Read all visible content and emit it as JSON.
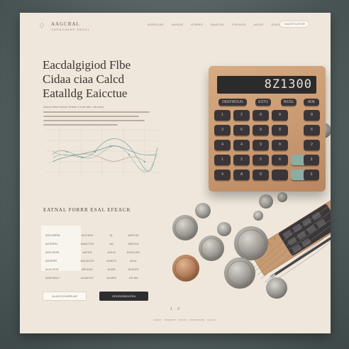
{
  "header": {
    "brand": "AAGCRAL",
    "brand_sub": "CAOUCAAKE SAOUL",
    "nav": [
      "AORGLAS",
      "AASOE",
      "GOERS",
      "EAATUA",
      "FOGAOS",
      "AOGS",
      "SOUAS",
      "AOAS"
    ],
    "cta": "CALESTLATIOR"
  },
  "hero": {
    "lines": [
      "Eacdalgigiod Flbe",
      "Cidaa ciaa Calcd",
      "Eatalldg Eaicctue"
    ],
    "body_label": "Aseon Addd tolloue Dhtme & fuse attu: cla nelcs"
  },
  "calculator": {
    "display": "8Z1300",
    "top_keys": [
      "DEEFWOUG",
      "ESTO",
      "RIUSL",
      "ADE"
    ],
    "key_rows": [
      [
        "1",
        "2",
        "8",
        "8",
        "8"
      ],
      [
        "3",
        "6",
        "8",
        "8",
        "6"
      ],
      [
        "4",
        "4",
        "9",
        "8",
        "2"
      ],
      [
        "1",
        "2",
        "5",
        "6",
        "3"
      ],
      [
        "4",
        "A",
        "D",
        "",
        "0"
      ]
    ]
  },
  "section": {
    "title": "EATNAL FORRR ESAL EFEACK",
    "table": [
      [
        "ASCORRM",
        "ACOSPA",
        "AL",
        "ASPLSE",
        ""
      ],
      [
        "ACSSRN",
        "AAACTSS",
        "AA",
        "ASECLE",
        ""
      ],
      [
        "ADCOESE",
        "AATEN",
        "AOLM",
        "ASACLEE",
        ""
      ],
      [
        "AZAERR",
        "AOLACOS",
        "AOECS",
        "ALAL",
        ""
      ],
      [
        "ALALSON",
        "ASLEAC",
        "ALMS",
        "ALELES",
        ""
      ],
      [
        "AUNTAALT",
        "ALAACLE",
        "ALAEM",
        "ATLAN",
        ""
      ]
    ]
  },
  "buttons": {
    "secondary": "ALAEGOOUERLAE",
    "primary": "GRORDEBOORIN"
  },
  "pager": "1 2",
  "footer": [
    "ALSOCT",
    "ESCENNM",
    "ALTCAS",
    "OOSOUSOUTE",
    "ALALSS"
  ]
}
